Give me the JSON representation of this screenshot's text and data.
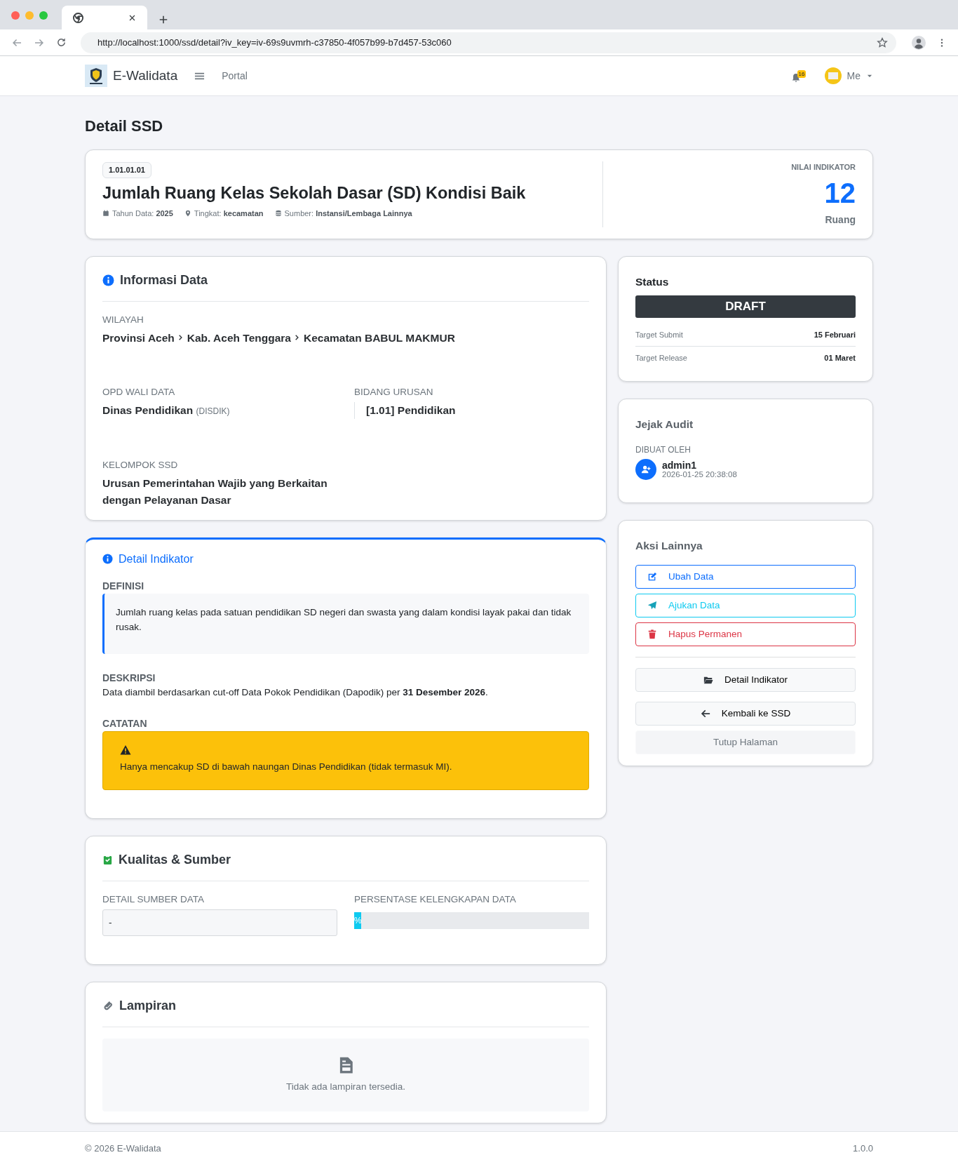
{
  "browser": {
    "url": "http://localhost:1000/ssd/detail?iv_key=iv-69s9uvmrh-c37850-4f057b99-b7d457-53c060"
  },
  "navbar": {
    "brand": "E-Walidata",
    "links": [
      "Portal"
    ],
    "notification_count": "16",
    "user": "Me"
  },
  "page_title": "Detail SSD",
  "header": {
    "code": "1.01.01.01",
    "title": "Jumlah Ruang Kelas Sekolah Dasar (SD) Kondisi Baik",
    "meta": [
      {
        "kind": "year",
        "label": "Tahun Data:",
        "value": "2025"
      },
      {
        "kind": "level",
        "label": "Tingkat:",
        "value": "kecamatan"
      },
      {
        "kind": "source",
        "label": "Sumber:",
        "value": "Instansi/Lembaga Lainnya"
      }
    ],
    "value_label": "NILAI INDIKATOR",
    "value": "12",
    "unit": "Ruang"
  },
  "info": {
    "title": "Informasi Data",
    "wilayah_label": "WILAYAH",
    "wilayah": [
      "Provinsi Aceh",
      "Kab. Aceh Tenggara",
      "Kecamatan BABUL MAKMUR"
    ],
    "opd_label": "OPD WALI DATA",
    "opd_name": "Dinas Pendidikan",
    "opd_abbr": "(DISDIK)",
    "bidang_label": "BIDANG URUSAN",
    "bidang": "[1.01] Pendidikan",
    "kelompok_label": "KELOMPOK SSD",
    "kelompok": "Urusan Pemerintahan Wajib yang Berkaitan dengan Pelayanan Dasar"
  },
  "detail": {
    "title": "Detail Indikator",
    "definisi_label": "DEFINISI",
    "definisi": "Jumlah ruang kelas pada satuan pendidikan SD negeri dan swasta yang dalam kondisi layak pakai dan tidak rusak.",
    "deskripsi_label": "DESKRIPSI",
    "deskripsi": "Data diambil berdasarkan cut-off Data Pokok Pendidikan (Dapodik) per **31 Desember 2026**.",
    "catatan_label": "CATATAN",
    "catatan": "Hanya mencakup SD di bawah naungan Dinas Pendidikan (tidak termasuk MI)."
  },
  "kualitas": {
    "title": "Kualitas & Sumber",
    "sumber_label": "DETAIL SUMBER DATA",
    "sumber": "-",
    "persentase_label": "PERSENTASE KELENGKAPAN DATA",
    "persentase": {
      "level": 0.03,
      "label": "%"
    }
  },
  "lampiran": {
    "title": "Lampiran",
    "empty": "Tidak ada lampiran tersedia."
  },
  "status": {
    "title": "Status",
    "badge": "DRAFT",
    "targets": [
      {
        "label": "Target Submit",
        "value": "15 Februari"
      },
      {
        "label": "Target Release",
        "value": "01 Maret"
      }
    ]
  },
  "audit": {
    "title": "Jejak Audit",
    "label": "DIBUAT OLEH",
    "user": "admin1",
    "time": "2026-01-25 20:38:08"
  },
  "actions": {
    "title": "Aksi Lainnya",
    "buttons": [
      {
        "kind": "edit",
        "label": "Ubah Data"
      },
      {
        "kind": "submit",
        "label": "Ajukan Data"
      },
      {
        "kind": "delete",
        "label": "Hapus Permanen"
      },
      {
        "kind": "detail",
        "label": "Detail Indikator"
      },
      {
        "kind": "back",
        "label": "Kembali ke SSD"
      },
      {
        "kind": "close",
        "label": "Tutup Halaman"
      }
    ]
  },
  "footer": {
    "copyright": "© 2026 E-Walidata",
    "version": "1.0.0"
  }
}
